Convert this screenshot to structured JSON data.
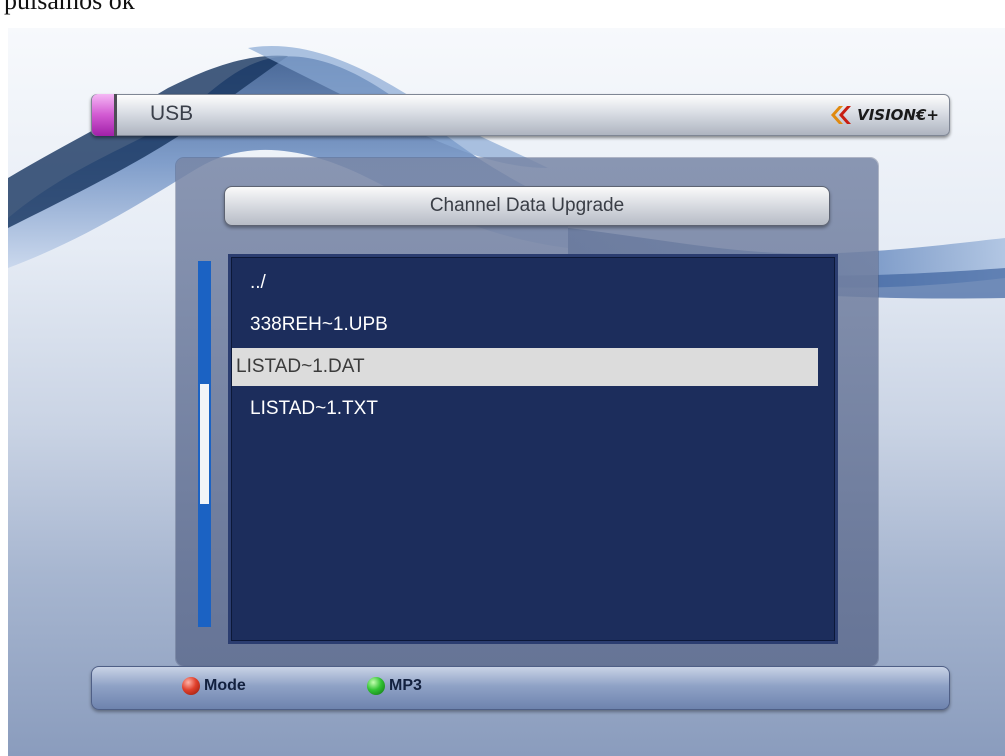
{
  "caption": "pulsamos ok",
  "header": {
    "title": "USB",
    "brand": "VISION€+"
  },
  "dialog": {
    "title": "Channel Data Upgrade",
    "files": [
      {
        "name": "../",
        "selected": false
      },
      {
        "name": "338REH~1.UPB",
        "selected": false
      },
      {
        "name": "LISTAD~1.DAT",
        "selected": true
      },
      {
        "name": "LISTAD~1.TXT",
        "selected": false
      }
    ]
  },
  "footer": {
    "red_label": "Mode",
    "green_label": "MP3"
  },
  "colors": {
    "list_background": "#1c2d5c",
    "selection_background": "#dcdcdc",
    "scrollbar": "#1b62c3",
    "tab_accent": "#d25ad2",
    "red_key": "#e0402c",
    "green_key": "#32c434"
  }
}
